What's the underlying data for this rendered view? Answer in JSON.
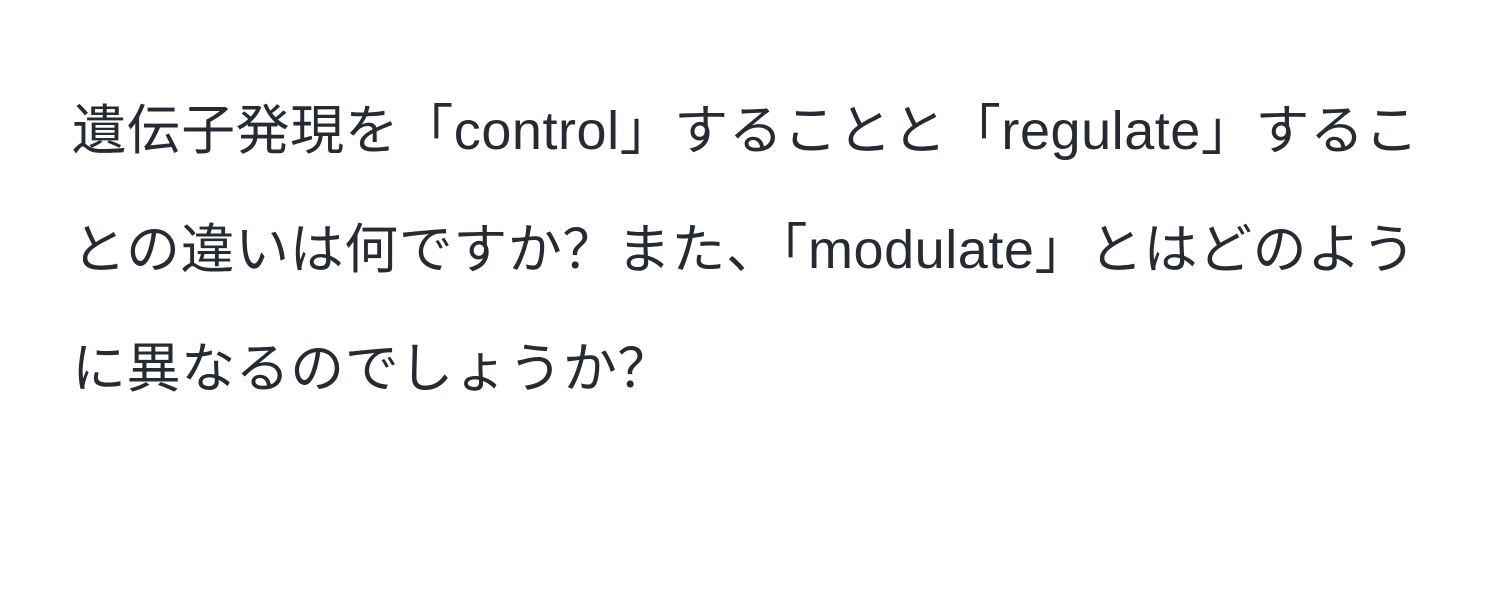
{
  "question": {
    "text": "遺伝子発現を「control」することと「regulate」することの違いは何ですか？また、「modulate」とはどのように異なるのでしょうか？"
  }
}
